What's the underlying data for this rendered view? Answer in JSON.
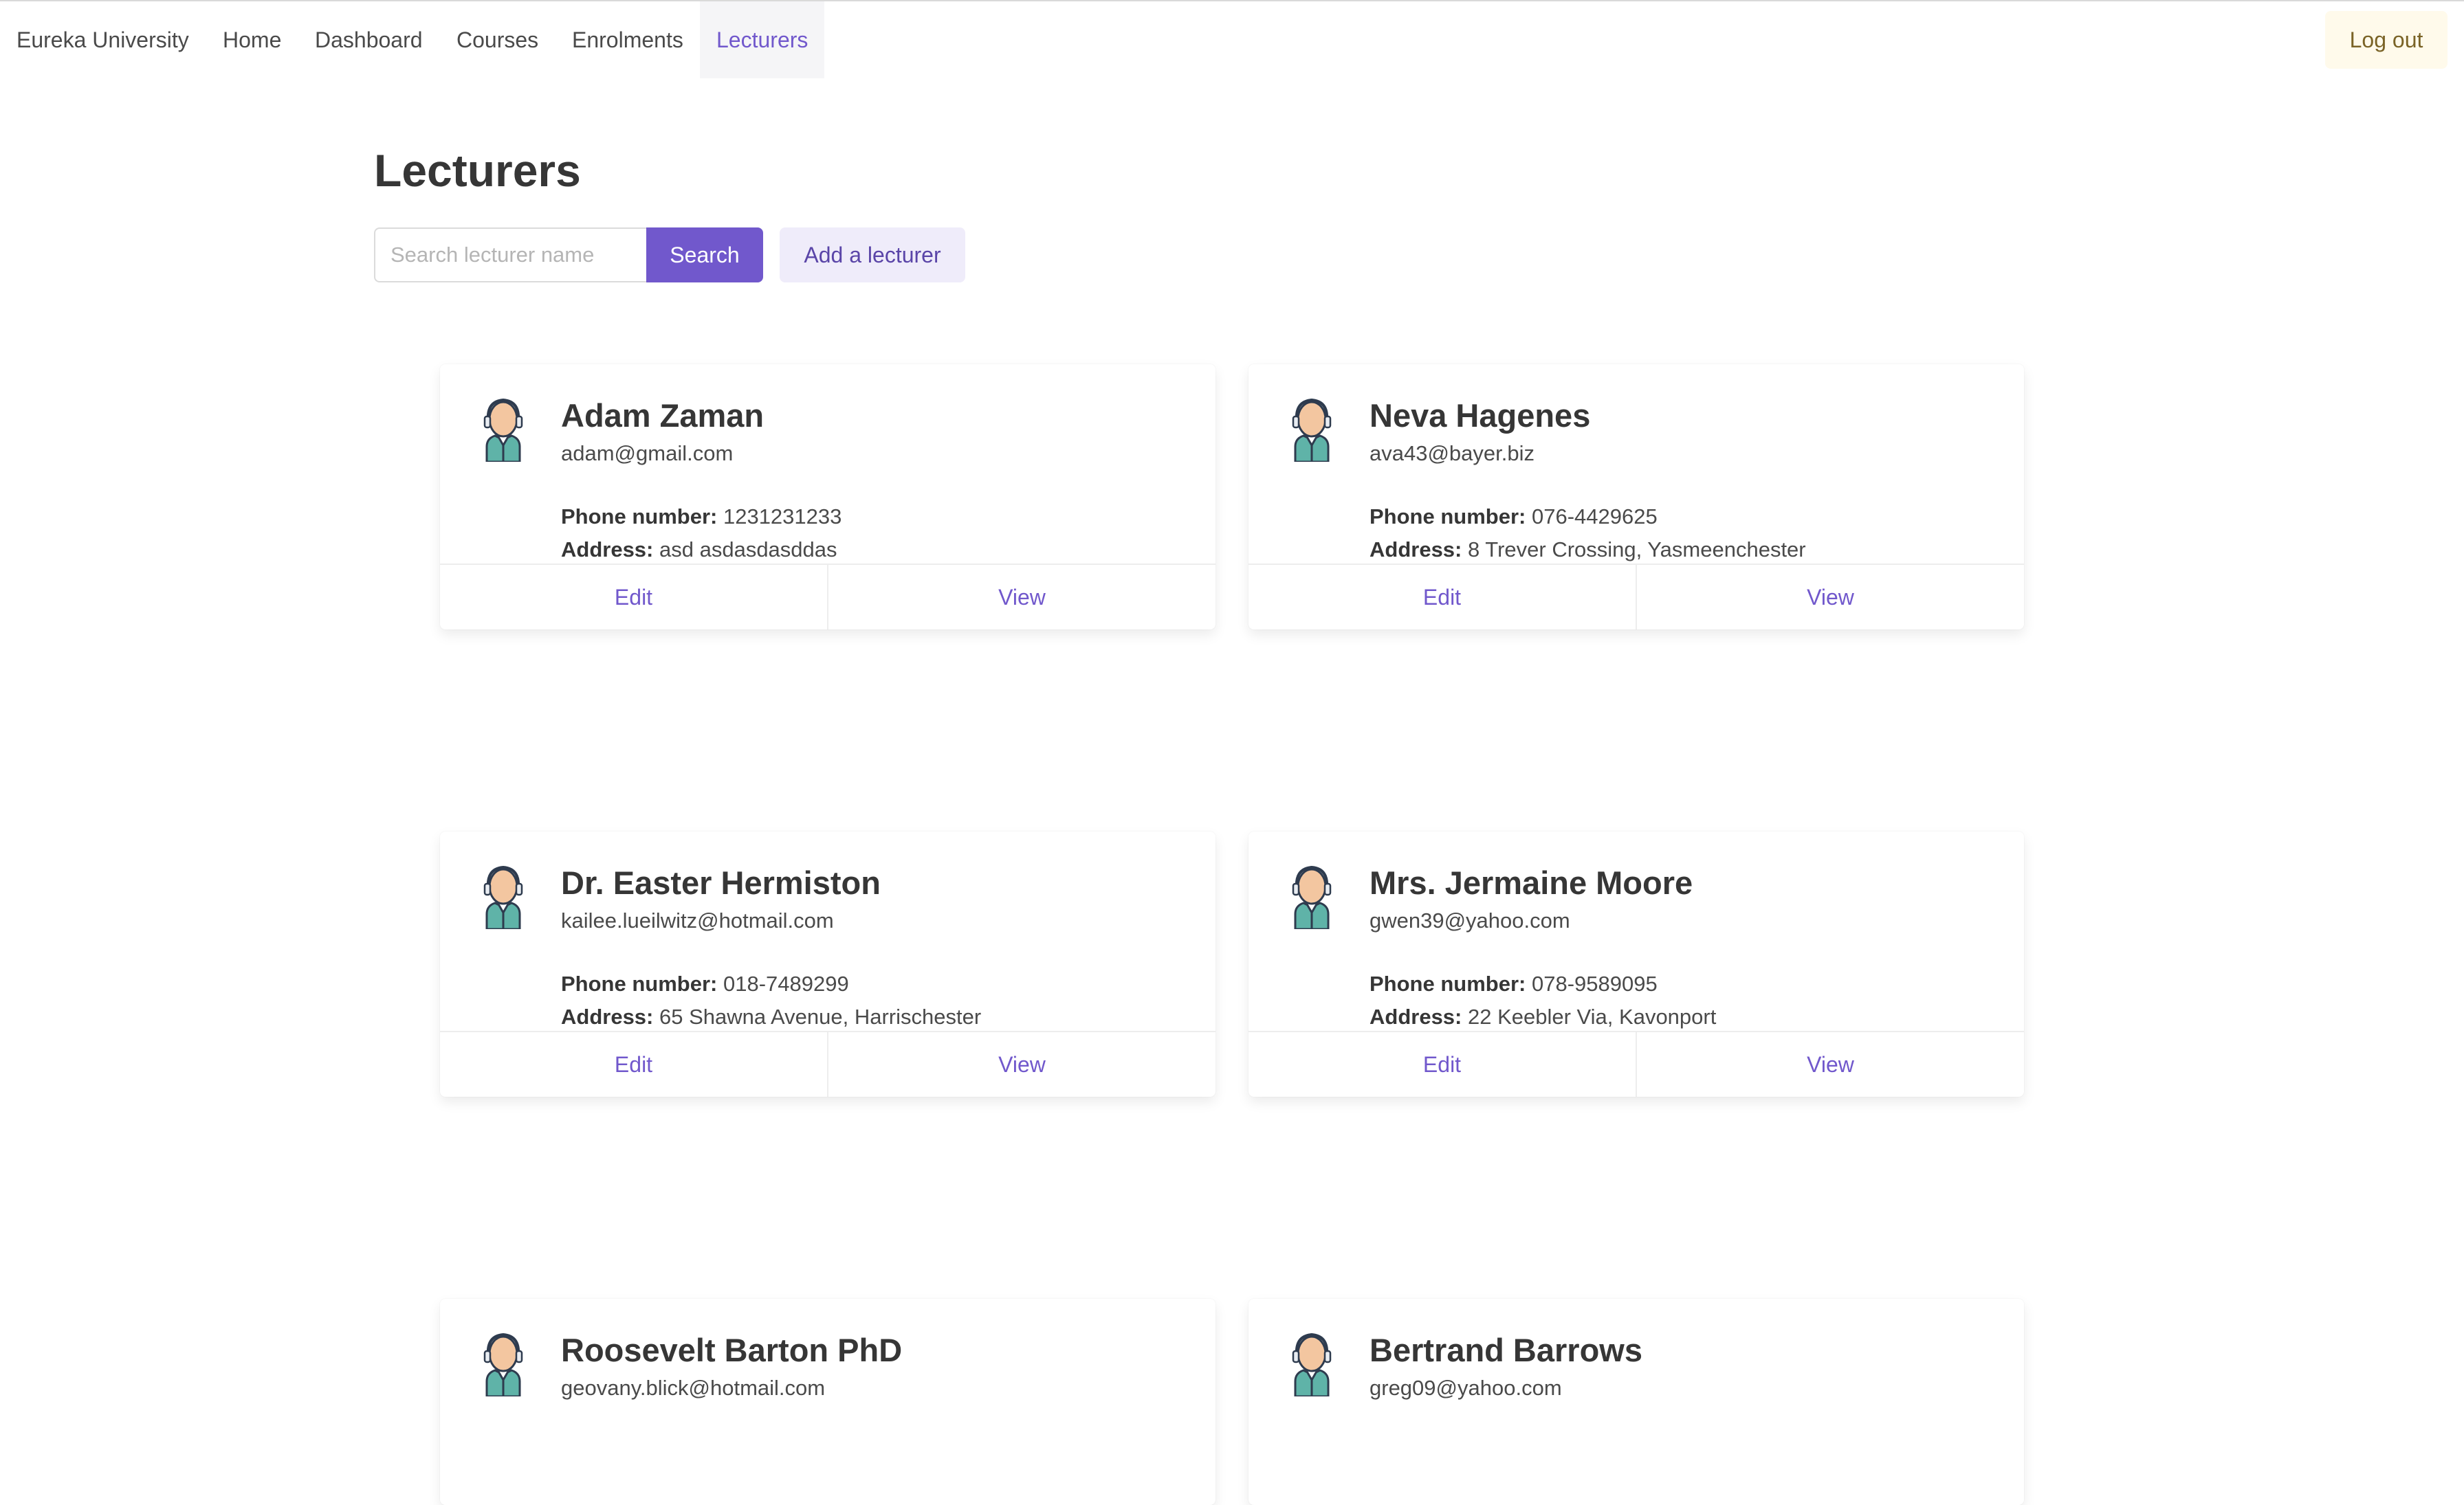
{
  "nav": {
    "brand": "Eureka University",
    "items": [
      {
        "label": "Home"
      },
      {
        "label": "Dashboard"
      },
      {
        "label": "Courses"
      },
      {
        "label": "Enrolments"
      },
      {
        "label": "Lecturers",
        "active": true
      }
    ],
    "logout_label": "Log out"
  },
  "page": {
    "title": "Lecturers"
  },
  "search": {
    "placeholder": "Search lecturer name",
    "value": "",
    "button_label": "Search"
  },
  "add_button_label": "Add a lecturer",
  "labels": {
    "phone": "Phone number:",
    "address": "Address:",
    "edit": "Edit",
    "view": "View"
  },
  "lecturers": [
    {
      "name": "Adam Zaman",
      "email": "adam@gmail.com",
      "phone": "1231231233",
      "address": "asd asdasdasddas"
    },
    {
      "name": "Neva Hagenes",
      "email": "ava43@bayer.biz",
      "phone": "076-4429625",
      "address": "8 Trever Crossing, Yasmeenchester"
    },
    {
      "name": "Dr. Easter Hermiston",
      "email": "kailee.lueilwitz@hotmail.com",
      "phone": "018-7489299",
      "address": "65 Shawna Avenue, Harrischester"
    },
    {
      "name": "Mrs. Jermaine Moore",
      "email": "gwen39@yahoo.com",
      "phone": "078-9589095",
      "address": "22 Keebler Via, Kavonport"
    },
    {
      "name": "Roosevelt Barton PhD",
      "email": "geovany.blick@hotmail.com"
    },
    {
      "name": "Bertrand Barrows",
      "email": "greg09@yahoo.com"
    }
  ],
  "colors": {
    "primary": "#7158cc",
    "primary_light": "#efecfa",
    "warning_light": "#fffaeb",
    "text": "#363636"
  },
  "icons": {
    "avatar": "lecturer-avatar-icon"
  }
}
